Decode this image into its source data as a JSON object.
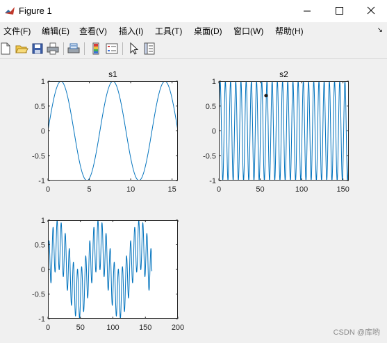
{
  "window": {
    "title": "Figure 1"
  },
  "menu": {
    "items": [
      "文件(F)",
      "编辑(E)",
      "查看(V)",
      "插入(I)",
      "工具(T)",
      "桌面(D)",
      "窗口(W)",
      "帮助(H)"
    ],
    "overflow_glyph": "↘"
  },
  "toolbar": {
    "icons": [
      "new-figure-icon",
      "open-file-icon",
      "save-icon",
      "print-icon",
      "print-preview-icon",
      "colorbar-icon",
      "legend-icon",
      "edit-plot-icon",
      "property-inspector-icon"
    ]
  },
  "colors": {
    "line": "#0072BD",
    "axes_bg": "#ffffff",
    "figure_bg": "#f0f0f0"
  },
  "watermark": "CSDN @库哟",
  "chart_data": [
    {
      "type": "line",
      "title": "s1",
      "xlabel": "",
      "ylabel": "",
      "xlim": [
        0,
        15.7
      ],
      "ylim": [
        -1,
        1
      ],
      "xticks": [
        0,
        5,
        10,
        15
      ],
      "yticks": [
        -1,
        -0.5,
        0,
        0.5,
        1
      ],
      "xtick_labels": [
        "0",
        "5",
        "10",
        "15"
      ],
      "ytick_labels": [
        "-1",
        "-0.5",
        "0",
        "0.5",
        "1"
      ],
      "function": "sin(x)",
      "x_range": [
        0,
        15.7
      ],
      "grid": false
    },
    {
      "type": "line",
      "title": "s2",
      "xlabel": "",
      "ylabel": "",
      "xlim": [
        0,
        157
      ],
      "ylim": [
        -1,
        1
      ],
      "xticks": [
        0,
        50,
        100,
        150
      ],
      "yticks": [
        -1,
        -0.5,
        0,
        0.5,
        1
      ],
      "xtick_labels": [
        "0",
        "50",
        "100",
        "150"
      ],
      "ytick_labels": [
        "-1",
        "-0.5",
        "0",
        "0.5",
        "1"
      ],
      "function": "sin(x)",
      "x_range": [
        0,
        157
      ],
      "marker_point": {
        "x": 57,
        "y": 0.71
      },
      "grid": false
    },
    {
      "type": "line",
      "title": "",
      "xlabel": "",
      "ylabel": "",
      "xlim": [
        0,
        200
      ],
      "ylim": [
        -1,
        1
      ],
      "xticks": [
        0,
        50,
        100,
        150,
        200
      ],
      "yticks": [
        -1,
        -0.5,
        0,
        0.5,
        1
      ],
      "xtick_labels": [
        "0",
        "50",
        "100",
        "150",
        "200"
      ],
      "ytick_labels": [
        "-1",
        "-0.5",
        "0",
        "0.5",
        "1"
      ],
      "function": "0.5*sin(x/10) + 0.5*sin(x)",
      "x_range": [
        0,
        160
      ],
      "grid": false
    }
  ]
}
